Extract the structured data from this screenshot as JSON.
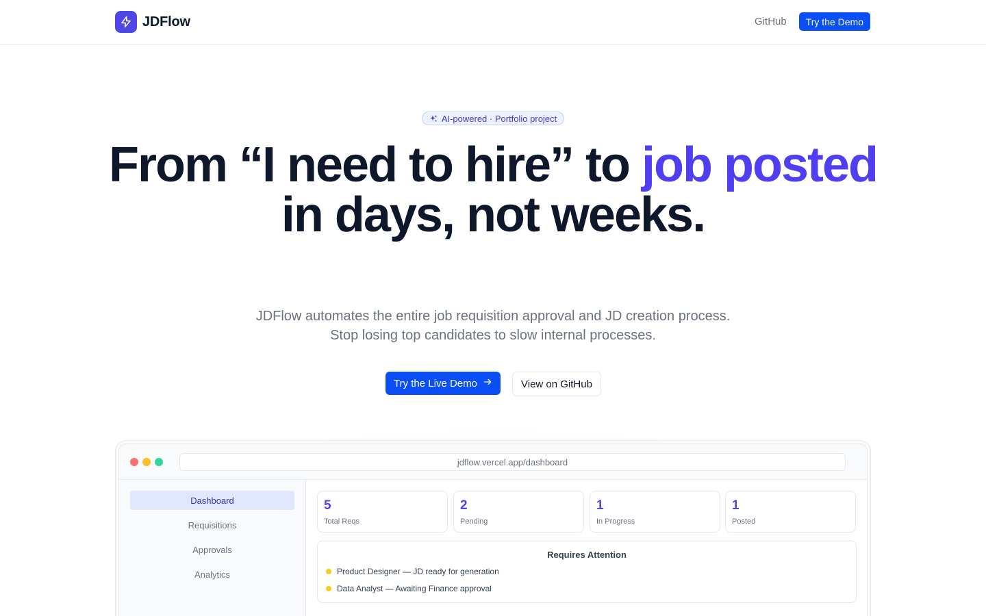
{
  "header": {
    "brand": "JDFlow",
    "github_link": "GitHub",
    "cta": "Try the Demo"
  },
  "hero": {
    "badge": "AI-powered · Portfolio project",
    "headline_part1": "From “I need to hire” to ",
    "headline_accent": "job posted",
    "headline_part2": "in days, not weeks.",
    "subtitle": "JDFlow automates the entire job requisition approval and JD creation process. Stop losing top candidates to slow internal processes.",
    "primary_button": "Try the Live Demo",
    "secondary_button": "View on GitHub"
  },
  "preview": {
    "url": "jdflow.vercel.app/dashboard",
    "sidebar": [
      {
        "label": "Dashboard",
        "active": true
      },
      {
        "label": "Requisitions",
        "active": false
      },
      {
        "label": "Approvals",
        "active": false
      },
      {
        "label": "Analytics",
        "active": false
      }
    ],
    "stats": [
      {
        "value": "5",
        "label": "Total Reqs"
      },
      {
        "value": "2",
        "label": "Pending"
      },
      {
        "value": "1",
        "label": "In Progress"
      },
      {
        "value": "1",
        "label": "Posted"
      }
    ],
    "attention": {
      "title": "Requires Attention",
      "items": [
        "Product Designer — JD ready for generation",
        "Data Analyst — Awaiting Finance approval"
      ]
    }
  },
  "colors": {
    "brand": "#4f46e5",
    "accent_text": "#4f3ff0",
    "primary_button": "#0a4ff5",
    "status_dot": "#facc15"
  },
  "icons": {
    "logo": "lightning-bolt-icon",
    "badge": "sparkles-icon",
    "button": "arrow-right-icon"
  }
}
